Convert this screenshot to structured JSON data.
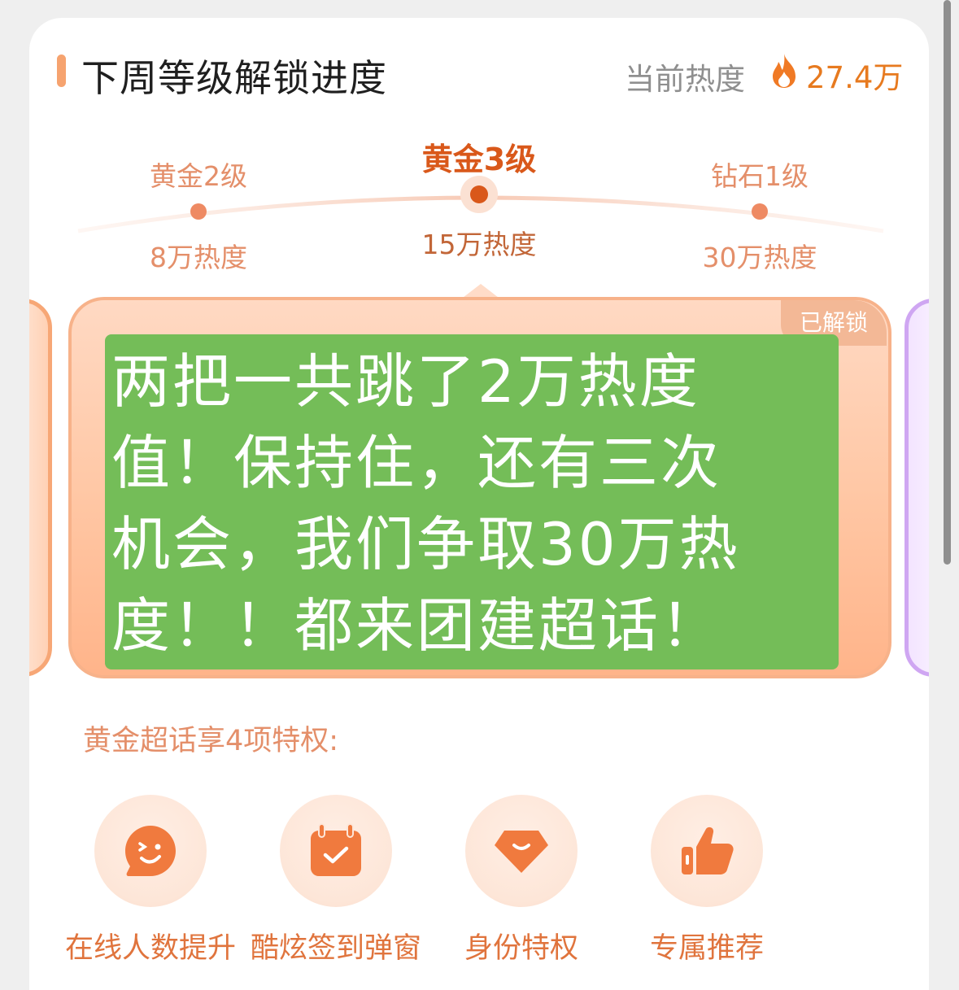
{
  "header": {
    "title": "下周等级解锁进度",
    "heat_label": "当前热度",
    "heat_value": "27.4万"
  },
  "levels": [
    {
      "name": "黄金2级",
      "heat": "8万热度"
    },
    {
      "name": "黄金3级",
      "heat": "15万热度"
    },
    {
      "name": "钻石1级",
      "heat": "30万热度"
    }
  ],
  "card": {
    "badge": "已解锁",
    "note_lines": [
      "两把一共跳了2万热度",
      "值！保持住，还有三次",
      "机会，我们争取30万热",
      "度！！都来团建超话！"
    ]
  },
  "privileges": {
    "title": "黄金超话享4项特权:",
    "items": [
      {
        "label": "在线人数提升",
        "icon": "smile-face-icon"
      },
      {
        "label": "酷炫签到弹窗",
        "icon": "calendar-check-icon"
      },
      {
        "label": "身份特权",
        "icon": "diamond-icon"
      },
      {
        "label": "专属推荐",
        "icon": "thumbs-up-icon"
      }
    ]
  },
  "colors": {
    "accent": "#e77a1f",
    "level_active": "#d9581a",
    "note_bg": "#74bd58"
  }
}
